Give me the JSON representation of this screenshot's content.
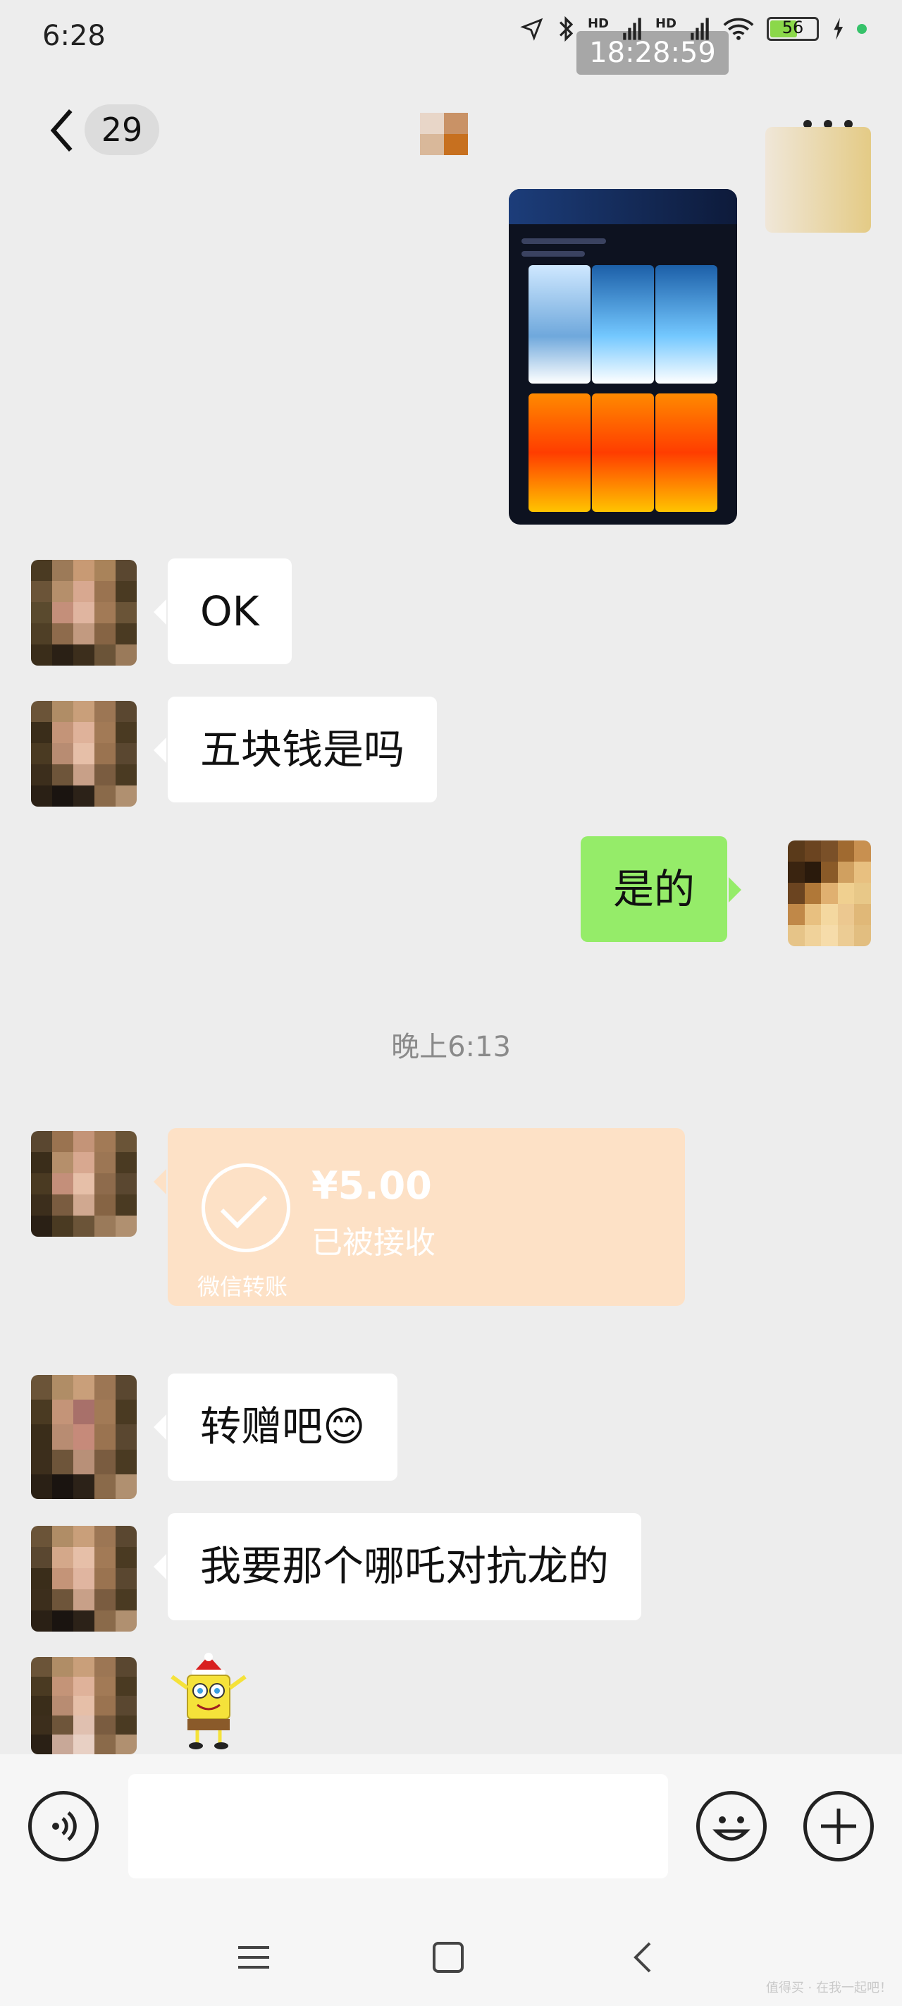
{
  "status_bar": {
    "time": "6:28",
    "overlay_time": "18:28:59",
    "network_labels": [
      "HD",
      "HD"
    ],
    "battery": "56",
    "icons": [
      "location-arrow-icon",
      "bluetooth-icon",
      "signal-icon",
      "signal-icon",
      "wifi-icon",
      "battery-icon",
      "charging-icon"
    ]
  },
  "navbar": {
    "unread_count": "29",
    "back_icon": "chevron-left-icon",
    "more_icon": "more-dots-icon"
  },
  "messages": [
    {
      "side": "right",
      "type": "image",
      "content_icon": "nft-collection-screenshot"
    },
    {
      "side": "left",
      "type": "text",
      "text": "OK"
    },
    {
      "side": "left",
      "type": "text",
      "text": "五块钱是吗"
    },
    {
      "side": "right",
      "type": "text",
      "text": "是的"
    },
    {
      "type": "timestamp",
      "text": "晚上6:13"
    },
    {
      "side": "left",
      "type": "transfer",
      "amount": "¥5.00",
      "status": "已被接收",
      "footer": "微信转账"
    },
    {
      "side": "left",
      "type": "text",
      "text": "转赠吧",
      "emoji": "😊"
    },
    {
      "side": "left",
      "type": "text",
      "text": "我要那个哪吒对抗龙的"
    },
    {
      "side": "left",
      "type": "sticker",
      "content_icon": "spongebob-sticker"
    }
  ],
  "input_bar": {
    "voice_icon": "voice-icon",
    "emoji_icon": "emoji-icon",
    "plus_icon": "plus-icon",
    "placeholder": ""
  },
  "system_nav": {
    "icons": [
      "menu-icon",
      "home-icon",
      "back-icon"
    ]
  },
  "watermark": "值得买 · 在我一起吧！"
}
